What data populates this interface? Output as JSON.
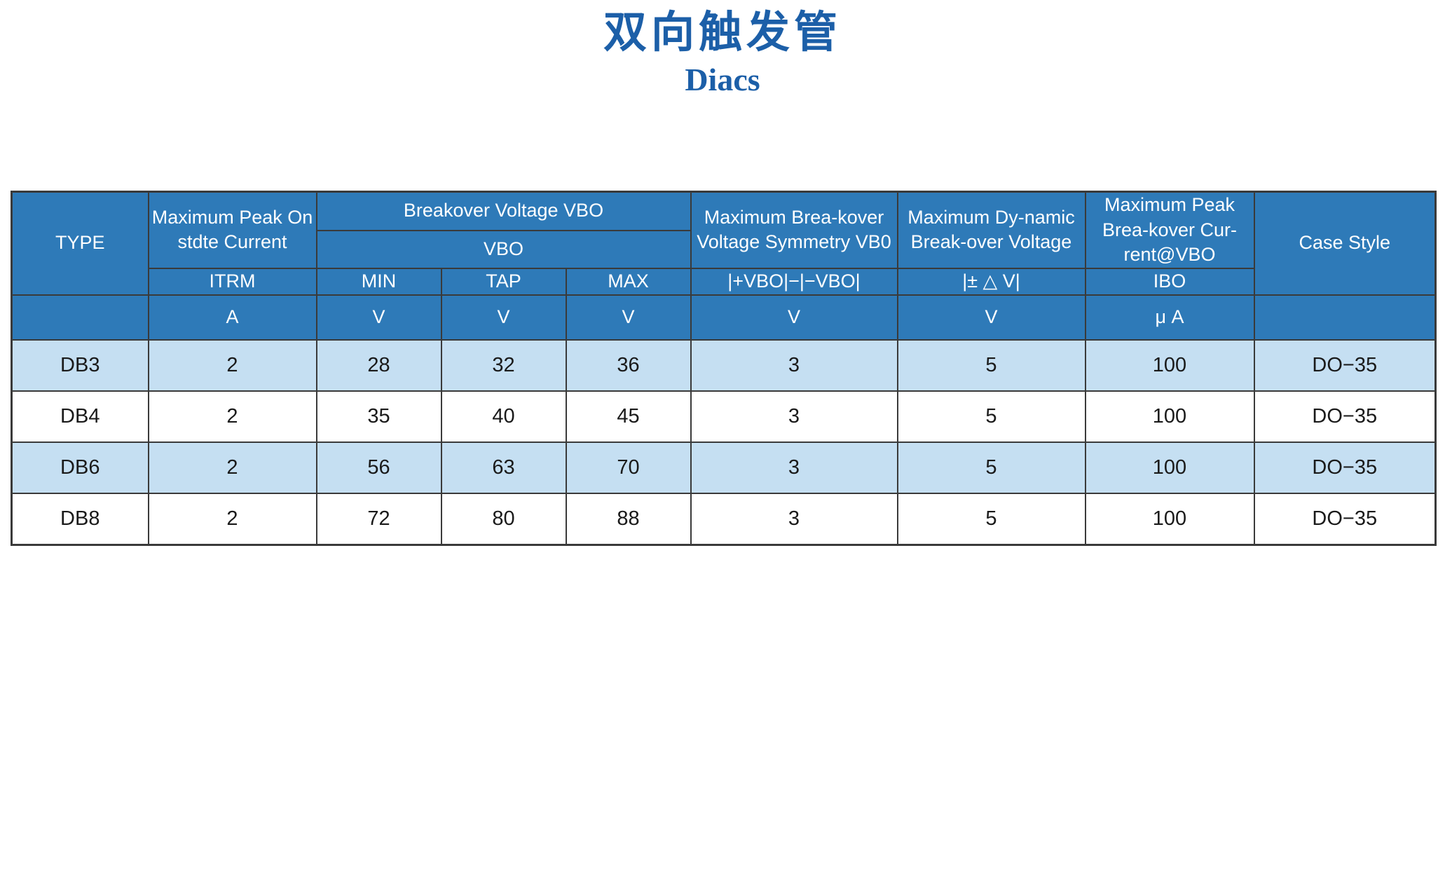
{
  "title": {
    "chinese": "双向触发管",
    "english": "Diacs",
    "color": "#1C5FA8"
  },
  "colors": {
    "header_blue": "#2E7AB8",
    "alt_row_blue": "#C5DFF2",
    "border": "#3a3a3a",
    "header_text": "#ffffff",
    "body_text": "#1a1a1a"
  },
  "table": {
    "header": {
      "type_label": "TYPE",
      "case_style_label": "Case Style",
      "groups": {
        "max_peak_on_state_current": "Maximum Peak On stdte Current",
        "breakover_voltage_vbo": "Breakover Voltage VBO",
        "max_breakover_voltage_symmetry": "Maximum Brea-kover Voltage Symmetry VB0",
        "max_dynamic_breakover_voltage": "Maximum Dy-namic Break-over Voltage",
        "max_peak_breakover_current": "Maximum Peak Brea-kover Cur-rent@VBO"
      },
      "symbols": {
        "itrm": "ITRM",
        "vbo": "VBO",
        "vbo_min": "MIN",
        "vbo_tap": "TAP",
        "vbo_max": "MAX",
        "symmetry": "|+VBO|−|−VBO|",
        "dynamic": "|± △ V|",
        "ibo": "IBO"
      },
      "units": {
        "itrm": "A",
        "vbo_min": "V",
        "vbo_tap": "V",
        "vbo_max": "V",
        "symmetry": "V",
        "dynamic": "V",
        "ibo": "μ A"
      }
    },
    "rows": [
      {
        "type": "DB3",
        "itrm": "2",
        "vbo_min": "28",
        "vbo_tap": "32",
        "vbo_max": "36",
        "symmetry": "3",
        "dynamic": "5",
        "ibo": "100",
        "case_style": "DO−35"
      },
      {
        "type": "DB4",
        "itrm": "2",
        "vbo_min": "35",
        "vbo_tap": "40",
        "vbo_max": "45",
        "symmetry": "3",
        "dynamic": "5",
        "ibo": "100",
        "case_style": "DO−35"
      },
      {
        "type": "DB6",
        "itrm": "2",
        "vbo_min": "56",
        "vbo_tap": "63",
        "vbo_max": "70",
        "symmetry": "3",
        "dynamic": "5",
        "ibo": "100",
        "case_style": "DO−35"
      },
      {
        "type": "DB8",
        "itrm": "2",
        "vbo_min": "72",
        "vbo_tap": "80",
        "vbo_max": "88",
        "symmetry": "3",
        "dynamic": "5",
        "ibo": "100",
        "case_style": "DO−35"
      }
    ]
  }
}
